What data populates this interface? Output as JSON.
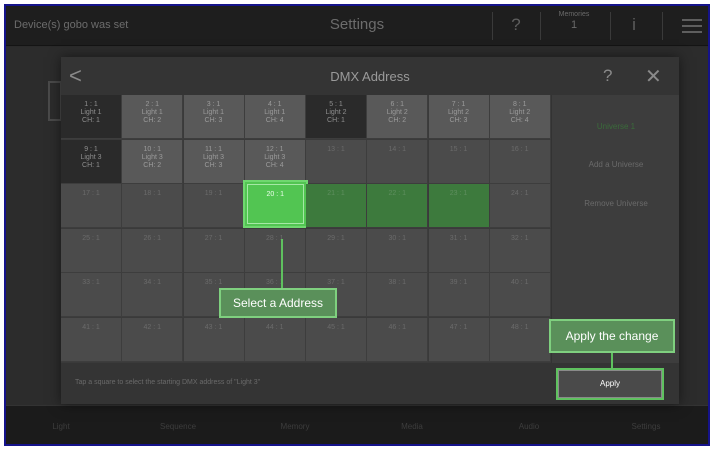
{
  "topbar": {
    "status": "Device(s) gobo was set",
    "title": "Settings",
    "help_icon": "?",
    "memory_label": "Memories",
    "memory_value": "1",
    "info_icon": "i"
  },
  "modal": {
    "back_icon": "<",
    "title": "DMX Address",
    "help_icon": "?",
    "close_icon": "✕",
    "grid": {
      "rows": [
        [
          {
            "addr": "1 : 1",
            "light": "Light 1",
            "ch": "CH: 1",
            "state": "occupied"
          },
          {
            "addr": "2 : 1",
            "light": "Light 1",
            "ch": "CH: 2",
            "state": "occupied"
          },
          {
            "addr": "3 : 1",
            "light": "Light 1",
            "ch": "CH: 3",
            "state": "occupied"
          },
          {
            "addr": "4 : 1",
            "light": "Light 1",
            "ch": "CH: 4",
            "state": "occupied"
          },
          {
            "addr": "5 : 1",
            "light": "Light 2",
            "ch": "CH: 1",
            "state": "occupied"
          },
          {
            "addr": "6 : 1",
            "light": "Light 2",
            "ch": "CH: 2",
            "state": "occupied"
          },
          {
            "addr": "7 : 1",
            "light": "Light 2",
            "ch": "CH: 3",
            "state": "occupied"
          },
          {
            "addr": "8 : 1",
            "light": "Light 2",
            "ch": "CH: 4",
            "state": "occupied"
          }
        ],
        [
          {
            "addr": "9 : 1",
            "light": "Light 3",
            "ch": "CH: 1",
            "state": "occupied"
          },
          {
            "addr": "10 : 1",
            "light": "Light 3",
            "ch": "CH: 2",
            "state": "occupied"
          },
          {
            "addr": "11 : 1",
            "light": "Light 3",
            "ch": "CH: 3",
            "state": "occupied"
          },
          {
            "addr": "12 : 1",
            "light": "Light 3",
            "ch": "CH: 4",
            "state": "occupied"
          },
          {
            "addr": "13 : 1",
            "state": "empty"
          },
          {
            "addr": "14 : 1",
            "state": "empty"
          },
          {
            "addr": "15 : 1",
            "state": "empty"
          },
          {
            "addr": "16 : 1",
            "state": "empty"
          }
        ],
        [
          {
            "addr": "17 : 1",
            "state": "empty"
          },
          {
            "addr": "18 : 1",
            "state": "empty"
          },
          {
            "addr": "19 : 1",
            "state": "empty"
          },
          {
            "addr": "20 : 1",
            "state": "selected"
          },
          {
            "addr": "21 : 1",
            "state": "highlight"
          },
          {
            "addr": "22 : 1",
            "state": "highlight"
          },
          {
            "addr": "23 : 1",
            "state": "highlight"
          },
          {
            "addr": "24 : 1",
            "state": "empty"
          }
        ],
        [
          {
            "addr": "25 : 1",
            "state": "empty"
          },
          {
            "addr": "26 : 1",
            "state": "empty"
          },
          {
            "addr": "27 : 1",
            "state": "empty"
          },
          {
            "addr": "28 : 1",
            "state": "empty"
          },
          {
            "addr": "29 : 1",
            "state": "empty"
          },
          {
            "addr": "30 : 1",
            "state": "empty"
          },
          {
            "addr": "31 : 1",
            "state": "empty"
          },
          {
            "addr": "32 : 1",
            "state": "empty"
          }
        ],
        [
          {
            "addr": "33 : 1",
            "state": "empty"
          },
          {
            "addr": "34 : 1",
            "state": "empty"
          },
          {
            "addr": "35 : 1",
            "state": "empty"
          },
          {
            "addr": "36 : 1",
            "state": "empty"
          },
          {
            "addr": "37 : 1",
            "state": "empty"
          },
          {
            "addr": "38 : 1",
            "state": "empty"
          },
          {
            "addr": "39 : 1",
            "state": "empty"
          },
          {
            "addr": "40 : 1",
            "state": "empty"
          }
        ],
        [
          {
            "addr": "41 : 1",
            "state": "empty"
          },
          {
            "addr": "42 : 1",
            "state": "empty"
          },
          {
            "addr": "43 : 1",
            "state": "empty"
          },
          {
            "addr": "44 : 1",
            "state": "empty"
          },
          {
            "addr": "45 : 1",
            "state": "empty"
          },
          {
            "addr": "46 : 1",
            "state": "empty"
          },
          {
            "addr": "47 : 1",
            "state": "empty"
          },
          {
            "addr": "48 : 1",
            "state": "empty"
          }
        ]
      ]
    },
    "side": {
      "universe": "Universe 1",
      "add": "Add a Universe",
      "remove": "Remove Universe"
    },
    "hint": "Tap a square to select the starting DMX address of \"Light 3\"",
    "apply_label": "Apply"
  },
  "callouts": {
    "select": "Select a Address",
    "apply": "Apply the change"
  },
  "bottomnav": [
    "Light",
    "Sequence",
    "Memory",
    "Media",
    "Audio",
    "Settings"
  ],
  "colors": {
    "accent_green": "#52c552",
    "callout_border": "#7fd07f",
    "frame_border": "#15138a"
  }
}
